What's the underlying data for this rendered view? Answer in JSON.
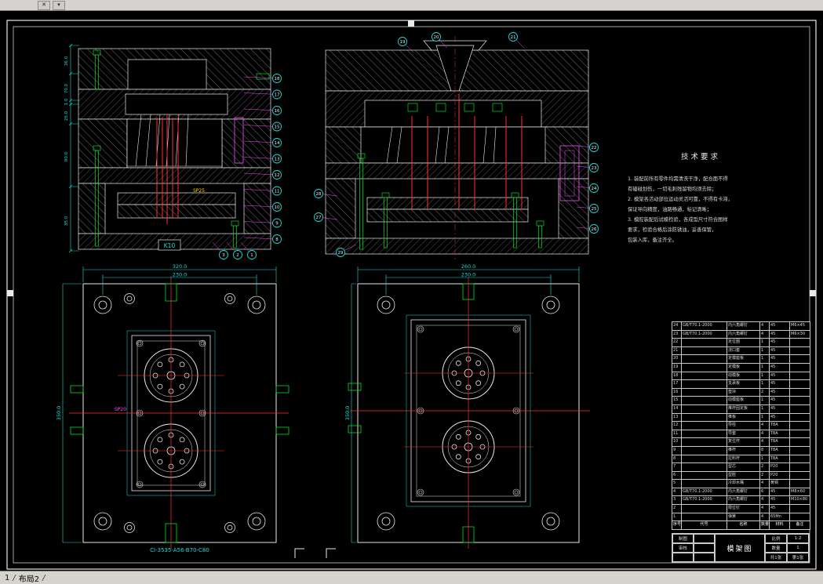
{
  "colors": {
    "background": "#000000",
    "line": "#e9e9e9",
    "dimension": "#00ffff",
    "centerline": "#ff0000",
    "hardware": "#00e020",
    "callout": "#ff4bff",
    "chrome": "#d6d3ce"
  },
  "toolbar": {
    "btn1": "✕",
    "btn2": "▾"
  },
  "tabs": {
    "model": "1",
    "sep1": "/",
    "layout": "布局2",
    "sep2": "/"
  },
  "tech": {
    "title": "技术要求",
    "lines": [
      "1. 装配前所有零件均需清洗干净，配合面不得",
      "   有磕碰划伤，一切毛刺残留物均须去除；",
      "2. 模架各活动部位运动灵活可靠，不得有卡滞，",
      "   保证导向精度，油路畅通，标记清晰；",
      "3. 模腔装配后试模检验，各成型尺寸符合图样",
      "   要求，检验合格后涂防锈油，妥善保管，",
      "   包装入库，备注齐全。"
    ]
  },
  "sec_left": {
    "dims": [
      "36.0",
      "70.0",
      "1.0",
      "25.0",
      "80.0",
      "35.0"
    ],
    "k_label": "K10",
    "sp_label": "SP25",
    "balloons_right": [
      "18",
      "17",
      "16",
      "15",
      "14",
      "13",
      "12",
      "11",
      "10",
      "9",
      "8"
    ],
    "balloons_bottom": [
      "3",
      "2",
      "1"
    ]
  },
  "sec_right": {
    "balloons_top": [
      "19",
      "20",
      "21"
    ],
    "balloons_right": [
      "22",
      "23",
      "24",
      "25",
      "26"
    ],
    "balloons_left": [
      "28",
      "27"
    ],
    "balloons_bottom": [
      "29"
    ]
  },
  "plan_left": {
    "dim_outer": "320.0",
    "dim_inner": "230.0",
    "dim_side": "350.0",
    "sp_label": "SP20",
    "code": "CI-3535-A56-B70-C80"
  },
  "plan_right": {
    "dim_outer": "260.0",
    "dim_inner": "230.0",
    "dim_side": "350.0"
  },
  "bom": {
    "header": [
      "序号",
      "代号",
      "名称",
      "数量",
      "材料",
      "备注"
    ],
    "rows": [
      [
        "24",
        "GB/T70.1-2000",
        "内六角螺钉",
        "4",
        "45",
        "M6×45"
      ],
      [
        "23",
        "GB/T70.1-2000",
        "内六角螺钉",
        "4",
        "45",
        "M6×30"
      ],
      [
        "22",
        "",
        "定位圈",
        "1",
        "45",
        ""
      ],
      [
        "21",
        "",
        "浇口套",
        "1",
        "45",
        ""
      ],
      [
        "20",
        "",
        "定模座板",
        "1",
        "45",
        ""
      ],
      [
        "19",
        "",
        "定模板",
        "1",
        "45",
        ""
      ],
      [
        "18",
        "",
        "动模板",
        "1",
        "45",
        ""
      ],
      [
        "17",
        "",
        "支承板",
        "1",
        "45",
        ""
      ],
      [
        "16",
        "",
        "垫块",
        "2",
        "45",
        ""
      ],
      [
        "15",
        "",
        "动模座板",
        "1",
        "45",
        ""
      ],
      [
        "14",
        "",
        "推杆固定板",
        "1",
        "45",
        ""
      ],
      [
        "13",
        "",
        "推板",
        "1",
        "45",
        ""
      ],
      [
        "12",
        "",
        "导柱",
        "4",
        "T8A",
        ""
      ],
      [
        "11",
        "",
        "导套",
        "4",
        "T8A",
        ""
      ],
      [
        "10",
        "",
        "复位杆",
        "4",
        "T8A",
        ""
      ],
      [
        "9",
        "",
        "推杆",
        "8",
        "T8A",
        ""
      ],
      [
        "8",
        "",
        "拉料杆",
        "1",
        "T8A",
        ""
      ],
      [
        "7",
        "",
        "型芯",
        "2",
        "P20",
        ""
      ],
      [
        "6",
        "",
        "型腔",
        "2",
        "P20",
        ""
      ],
      [
        "5",
        "",
        "冷却水嘴",
        "4",
        "黄铜",
        ""
      ],
      [
        "4",
        "GB/T70.1-2000",
        "内六角螺钉",
        "6",
        "45",
        "M8×60"
      ],
      [
        "3",
        "GB/T70.1-2000",
        "内六角螺钉",
        "4",
        "45",
        "M10×80"
      ],
      [
        "2",
        "",
        "限位钉",
        "4",
        "45",
        ""
      ],
      [
        "1",
        "",
        "弹簧",
        "4",
        "65Mn",
        ""
      ]
    ]
  },
  "title_block": {
    "drawn": "制图",
    "checked": "审核",
    "name": "模架图",
    "scale_label": "比例",
    "scale": "1:2",
    "qty_label": "数量",
    "qty": "1",
    "sheets": "共1张",
    "sheet": "第1张"
  }
}
